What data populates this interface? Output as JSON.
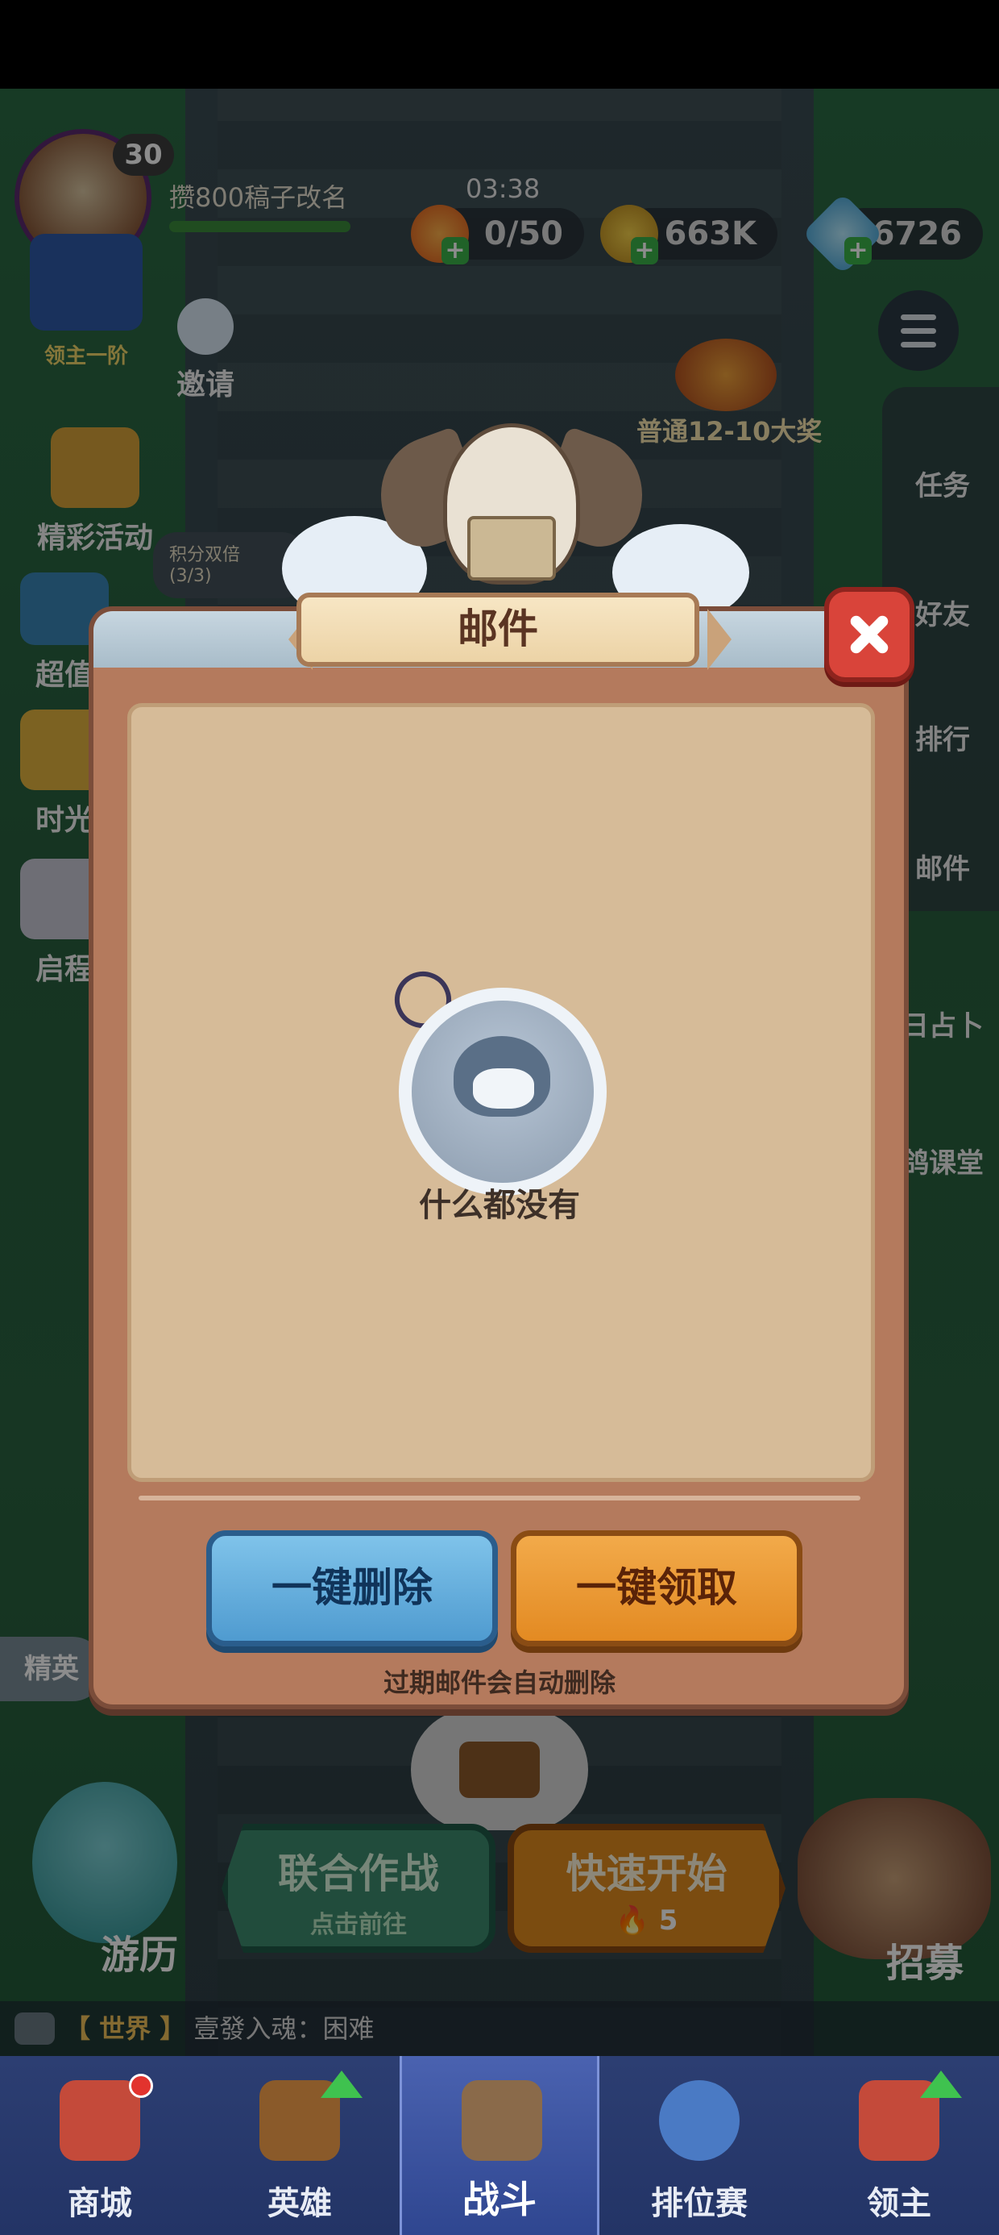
{
  "hud": {
    "level": "30",
    "rename_task": "攒800稿子改名",
    "timer": "03:38",
    "energy": "0/50",
    "gold": "663K",
    "gems": "6726",
    "lord_step": "领主一阶",
    "invite": "邀请",
    "activity": "精彩活动",
    "super_value": "超值",
    "time_light": "时光",
    "journey": "启程",
    "grand_prize": "普通12-10大奖",
    "points_double": "积分双倍",
    "points_double_count": "(3/3)"
  },
  "right_menu": {
    "tasks": "任务",
    "friends": "好友",
    "ranking": "排行",
    "mail": "邮件",
    "divination": "日占卜",
    "classroom": "鸽课堂"
  },
  "scene": {
    "elite": "精英",
    "travel": "游历",
    "coop_battle": "联合作战",
    "coop_sub": "点击前往",
    "quick_start": "快速开始",
    "quick_cost": "5",
    "recruit": "招募"
  },
  "chat": {
    "channel": "【 世界 】",
    "message": "壹發入魂：困难"
  },
  "nav": {
    "shop": "商城",
    "heroes": "英雄",
    "battle": "战斗",
    "ranked": "排位赛",
    "lord": "领主"
  },
  "modal": {
    "title": "邮件",
    "empty_text": "什么都没有",
    "delete_all": "一键删除",
    "claim_all": "一键领取",
    "auto_delete_note": "过期邮件会自动删除"
  },
  "colors": {
    "modal_frame": "#b47a5d",
    "paper": "#d6bb98",
    "delete_button": "#4f9bd0",
    "claim_button": "#e38a22",
    "close_button": "#d9443a"
  }
}
